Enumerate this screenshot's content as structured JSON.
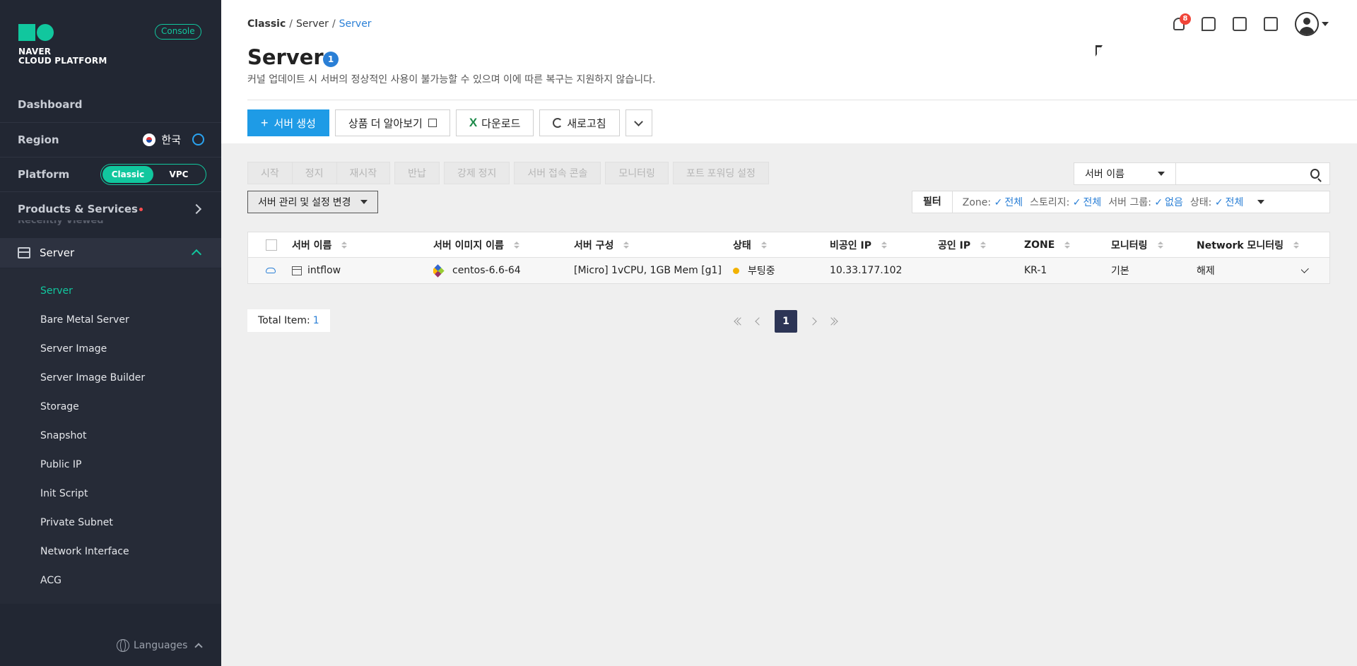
{
  "brand": {
    "line1": "NAVER",
    "line2": "CLOUD PLATFORM",
    "console_badge": "Console",
    "accent": "#11c79e"
  },
  "sidebar": {
    "dashboard": "Dashboard",
    "region_label": "Region",
    "region_value": "한국",
    "platform_label": "Platform",
    "platform_options": [
      "Classic",
      "VPC"
    ],
    "platform_selected": "Classic",
    "products_label": "Products & Services",
    "recently_viewed": "Recently Viewed",
    "section_label": "Server",
    "items": [
      {
        "label": "Server",
        "active": true
      },
      {
        "label": "Bare Metal Server"
      },
      {
        "label": "Server Image"
      },
      {
        "label": "Server Image Builder"
      },
      {
        "label": "Storage"
      },
      {
        "label": "Snapshot"
      },
      {
        "label": "Public IP"
      },
      {
        "label": "Init Script"
      },
      {
        "label": "Private Subnet"
      },
      {
        "label": "Network Interface"
      },
      {
        "label": "ACG"
      }
    ],
    "languages": "Languages"
  },
  "header": {
    "breadcrumb": [
      "Classic",
      "Server",
      "Server"
    ],
    "notification_count": "8",
    "icons": [
      "bell-icon",
      "chat-icon",
      "notes-icon",
      "info-icon",
      "user-icon"
    ]
  },
  "page": {
    "title": "Server",
    "count": "1",
    "notice": "커널 업데이트 시 서버의 정상적인 사용이 불가능할 수 있으며 이에 따른 복구는 지원하지 않습니다.",
    "buttons": {
      "create": "서버 생성",
      "learn_more": "상품 더 알아보기",
      "download": "다운로드",
      "refresh": "새로고침"
    }
  },
  "actions": {
    "group1": [
      "시작",
      "정지",
      "재시작"
    ],
    "group2": [
      "반납"
    ],
    "group3": [
      "강제 정지"
    ],
    "group4": [
      "서버 접속 콘솔"
    ],
    "group5": [
      "모니터링"
    ],
    "group6": [
      "포트 포워딩 설정"
    ],
    "manage": "서버 관리 및 설정 변경"
  },
  "search": {
    "select": "서버 이름",
    "placeholder": ""
  },
  "filter": {
    "label": "필터",
    "items": [
      {
        "key": "Zone:",
        "value": "전체"
      },
      {
        "key": "스토리지:",
        "value": "전체"
      },
      {
        "key": "서버 그룹:",
        "value": "없음"
      },
      {
        "key": "상태:",
        "value": "전체"
      }
    ]
  },
  "table": {
    "columns": [
      "서버 이름",
      "서버 이미지 이름",
      "서버 구성",
      "상태",
      "비공인 IP",
      "공인 IP",
      "ZONE",
      "모니터링",
      "Network 모니터링"
    ],
    "rows": [
      {
        "name": "intflow",
        "image": "centos-6.6-64",
        "spec": "[Micro] 1vCPU, 1GB Mem [g1]",
        "status": "부팅중",
        "private_ip": "10.33.177.102",
        "public_ip": "",
        "zone": "KR-1",
        "monitoring": "기본",
        "network_monitoring": "해제"
      }
    ]
  },
  "footer": {
    "total_label": "Total Item:",
    "total_value": "1",
    "current_page": "1"
  }
}
